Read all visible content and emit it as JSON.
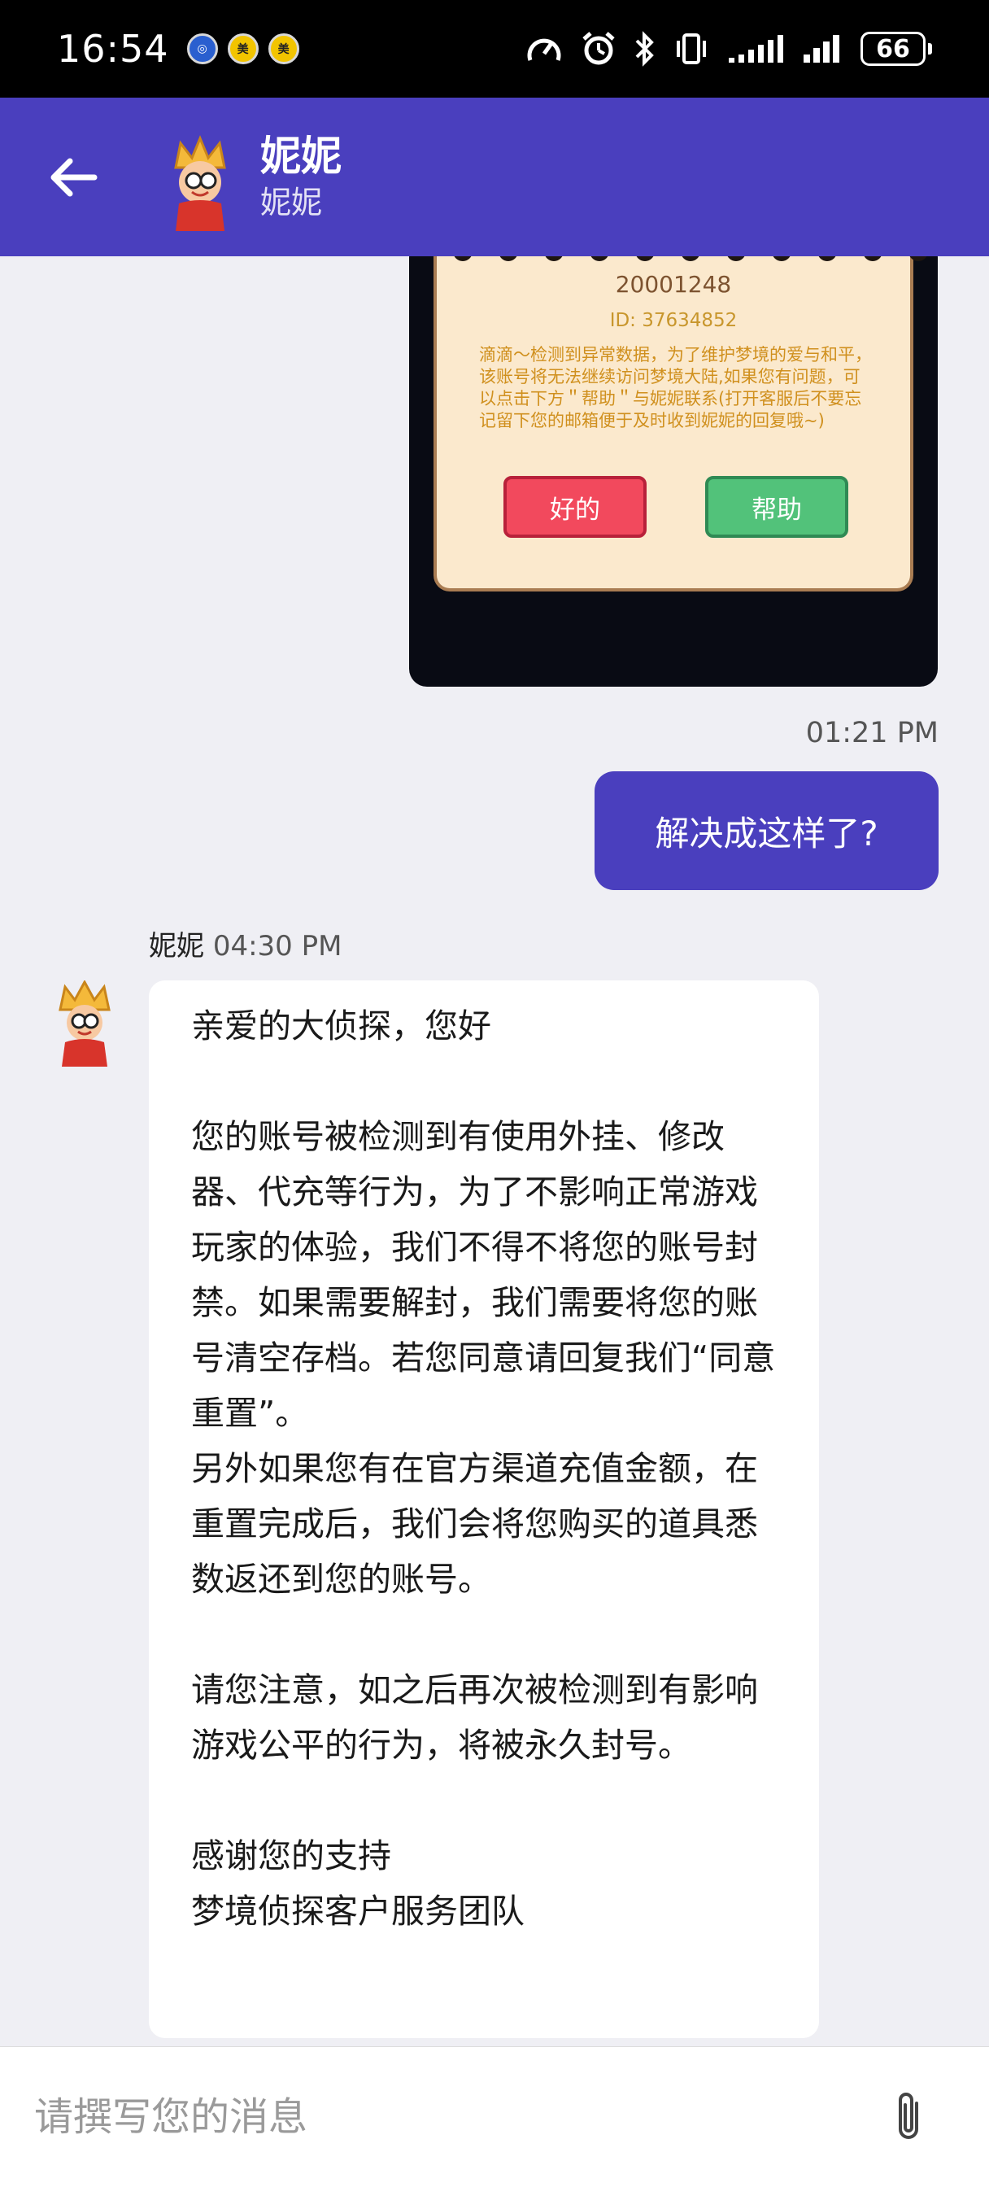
{
  "status_bar": {
    "time": "16:54",
    "left_icons": [
      "target-icon",
      "meituan-icon",
      "meituan-icon"
    ],
    "right_icons": [
      "speed-icon",
      "alarm-icon",
      "bluetooth-icon",
      "vibrate-icon",
      "signal-icon",
      "signal-icon"
    ],
    "battery": "66"
  },
  "header": {
    "title": "妮妮",
    "subtitle": "妮妮",
    "accent_color": "#4a3fbe"
  },
  "chat": {
    "image_message": {
      "code": "20001248",
      "id_line": "ID: 37634852",
      "body": "滴滴～检测到异常数据，为了维护梦境的爱与和平，该账号将无法继续访问梦境大陆,如果您有问题，可以点击下方＂帮助＂与妮妮联系(打开客服后不要忘记留下您的邮箱便于及时收到妮妮的回复哦~)",
      "ok_label": "好的",
      "help_label": "帮助"
    },
    "outgoing": {
      "time": "01:21 PM",
      "text": "解决成这样了?"
    },
    "incoming": {
      "sender": "妮妮",
      "time": "04:30 PM",
      "text": "亲爱的大侦探，您好\n\n您的账号被检测到有使用外挂、修改器、代充等行为，为了不影响正常游戏玩家的体验，我们不得不将您的账号封禁。如果需要解封，我们需要将您的账号清空存档。若您同意请回复我们“同意重置”。\n另外如果您有在官方渠道充值金额，在重置完成后，我们会将您购买的道具悉数返还到您的账号。\n\n请您注意，如之后再次被检测到有影响游戏公平的行为，将被永久封号。\n\n感谢您的支持\n梦境侦探客户服务团队"
    }
  },
  "composer": {
    "placeholder": "请撰写您的消息",
    "value": ""
  }
}
